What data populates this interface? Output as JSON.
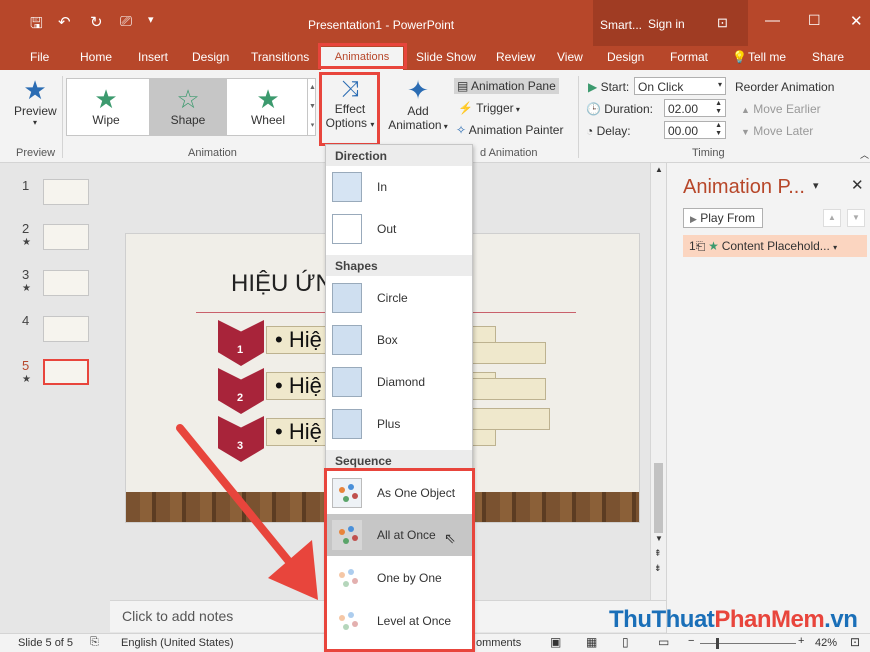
{
  "window": {
    "title": "Presentation1  -  PowerPoint",
    "context_group": "Smart...",
    "signin": "Sign in"
  },
  "tabs": [
    {
      "label": "File"
    },
    {
      "label": "Home"
    },
    {
      "label": "Insert"
    },
    {
      "label": "Design"
    },
    {
      "label": "Transitions"
    },
    {
      "label": "Animations"
    },
    {
      "label": "Slide Show"
    },
    {
      "label": "Review"
    },
    {
      "label": "View"
    },
    {
      "label": "Design"
    },
    {
      "label": "Format"
    }
  ],
  "tellme": "Tell me",
  "share": "Share",
  "ribbon": {
    "preview": {
      "label": "Preview",
      "group": "Preview"
    },
    "animation_group": "Animation",
    "gallery": [
      {
        "label": "Wipe"
      },
      {
        "label": "Shape"
      },
      {
        "label": "Wheel"
      }
    ],
    "effect_options": {
      "line1": "Effect",
      "line2": "Options"
    },
    "add_animation": {
      "line1": "Add",
      "line2": "Animation"
    },
    "animation_pane": "Animation Pane",
    "trigger": "Trigger",
    "animation_painter": "Animation Painter",
    "advanced_group_partial": "d Animation",
    "timing": {
      "group": "Timing",
      "start_label": "Start:",
      "start_value": "On Click",
      "duration_label": "Duration:",
      "duration_value": "02.00",
      "delay_label": "Delay:",
      "delay_value": "00.00",
      "reorder": "Reorder Animation",
      "move_earlier": "Move Earlier",
      "move_later": "Move Later"
    }
  },
  "slides": [
    {
      "num": "1",
      "star": ""
    },
    {
      "num": "2",
      "star": "★"
    },
    {
      "num": "3",
      "star": "★"
    },
    {
      "num": "4",
      "star": ""
    },
    {
      "num": "5",
      "star": "★"
    }
  ],
  "slide": {
    "title": "HIỆU ỨN           RT ART",
    "bullets": [
      "• Hiệ",
      "• Hiệ",
      "• Hiệ"
    ],
    "numbers": [
      "1",
      "2",
      "3"
    ]
  },
  "notes_placeholder": "Click to add notes",
  "anim_pane": {
    "title": "Animation P...",
    "play_from": "Play From",
    "item_num": "1",
    "item_label": "Content Placehold..."
  },
  "menu": {
    "direction_head": "Direction",
    "direction": [
      {
        "label": "In"
      },
      {
        "label": "Out"
      }
    ],
    "shapes_head": "Shapes",
    "shapes": [
      {
        "label": "Circle"
      },
      {
        "label": "Box"
      },
      {
        "label": "Diamond"
      },
      {
        "label": "Plus"
      }
    ],
    "sequence_head": "Sequence",
    "sequence": [
      {
        "label": "As One Object"
      },
      {
        "label": "All at Once"
      },
      {
        "label": "One by One"
      },
      {
        "label": "Level at Once"
      }
    ]
  },
  "status": {
    "slide": "Slide 5 of 5",
    "language": "English (United States)",
    "comments": "omments",
    "zoom": "42%"
  },
  "watermark": {
    "part1": "ThuThuat",
    "part2": "PhanMem",
    "part3": ".vn"
  },
  "colors": {
    "accent": "#b7472a",
    "highlight_box": "#e8453c",
    "star_green": "#3c9a6e"
  }
}
